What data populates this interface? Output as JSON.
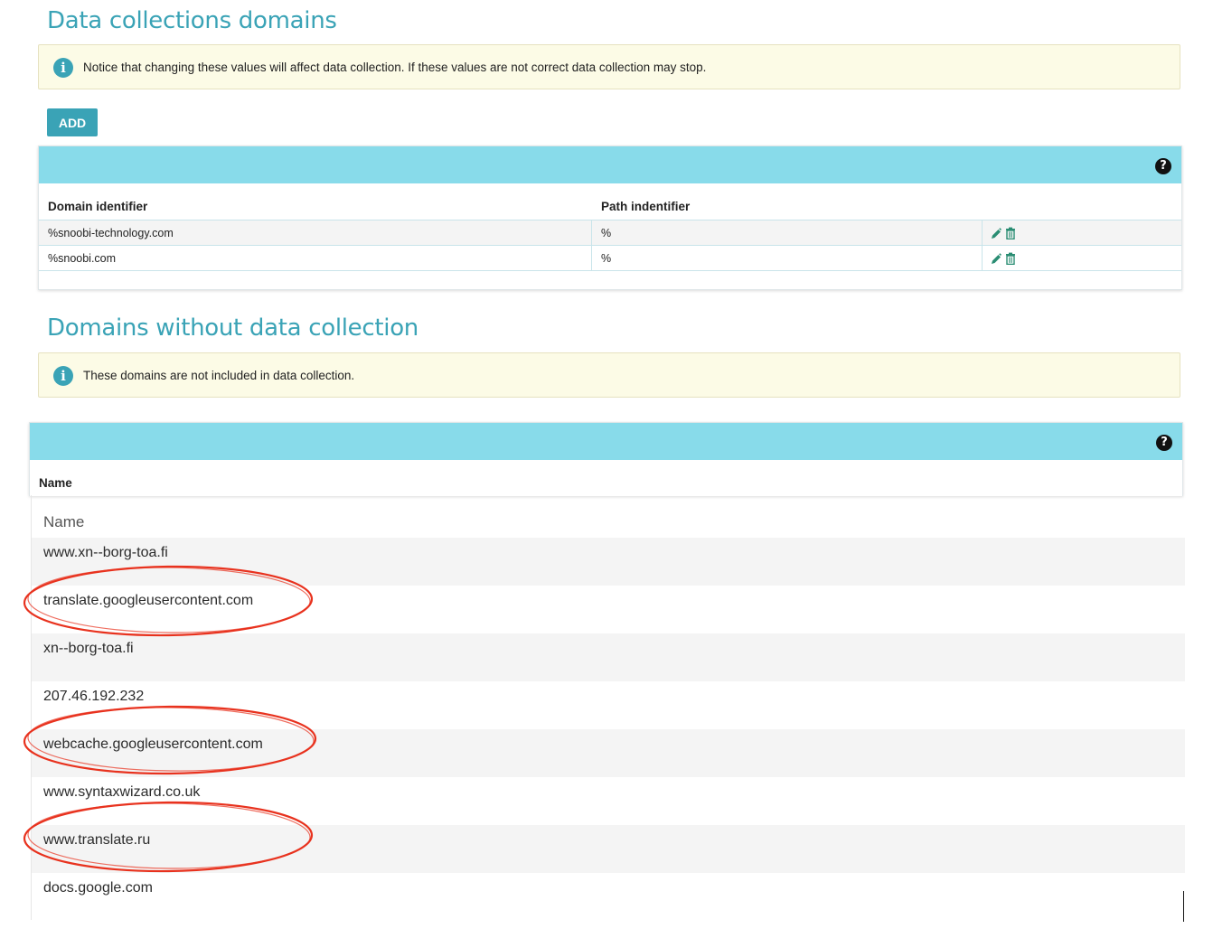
{
  "section1": {
    "title": "Data collections domains",
    "notice": "Notice that changing these values will affect data collection. If these values are not correct data collection may stop.",
    "add_label": "ADD",
    "columns": [
      "Domain identifier",
      "Path indentifier"
    ],
    "rows": [
      {
        "domain": "%snoobi-technology.com",
        "path": "%"
      },
      {
        "domain": "%snoobi.com",
        "path": "%"
      }
    ],
    "help_glyph": "?"
  },
  "section2": {
    "title": "Domains without data collection",
    "notice": "These domains are not included in data collection.",
    "column": "Name",
    "help_glyph": "?"
  },
  "list": {
    "header": "Name",
    "items": [
      "www.xn--borg-toa.fi",
      "translate.googleusercontent.com",
      "xn--borg-toa.fi",
      "207.46.192.232",
      "webcache.googleusercontent.com",
      "www.syntaxwizard.co.uk",
      "www.translate.ru",
      "docs.google.com"
    ],
    "highlighted": [
      "translate.googleusercontent.com",
      "webcache.googleusercontent.com",
      "www.translate.ru"
    ]
  },
  "icons": {
    "info": "info-icon",
    "help": "question-circle-icon",
    "edit": "pencil-icon",
    "delete": "trash-icon"
  },
  "colors": {
    "accent": "#3aa3b6",
    "panel_header": "#88dbea",
    "notice_bg": "#fcfbe6",
    "annotation": "#e8321e"
  }
}
